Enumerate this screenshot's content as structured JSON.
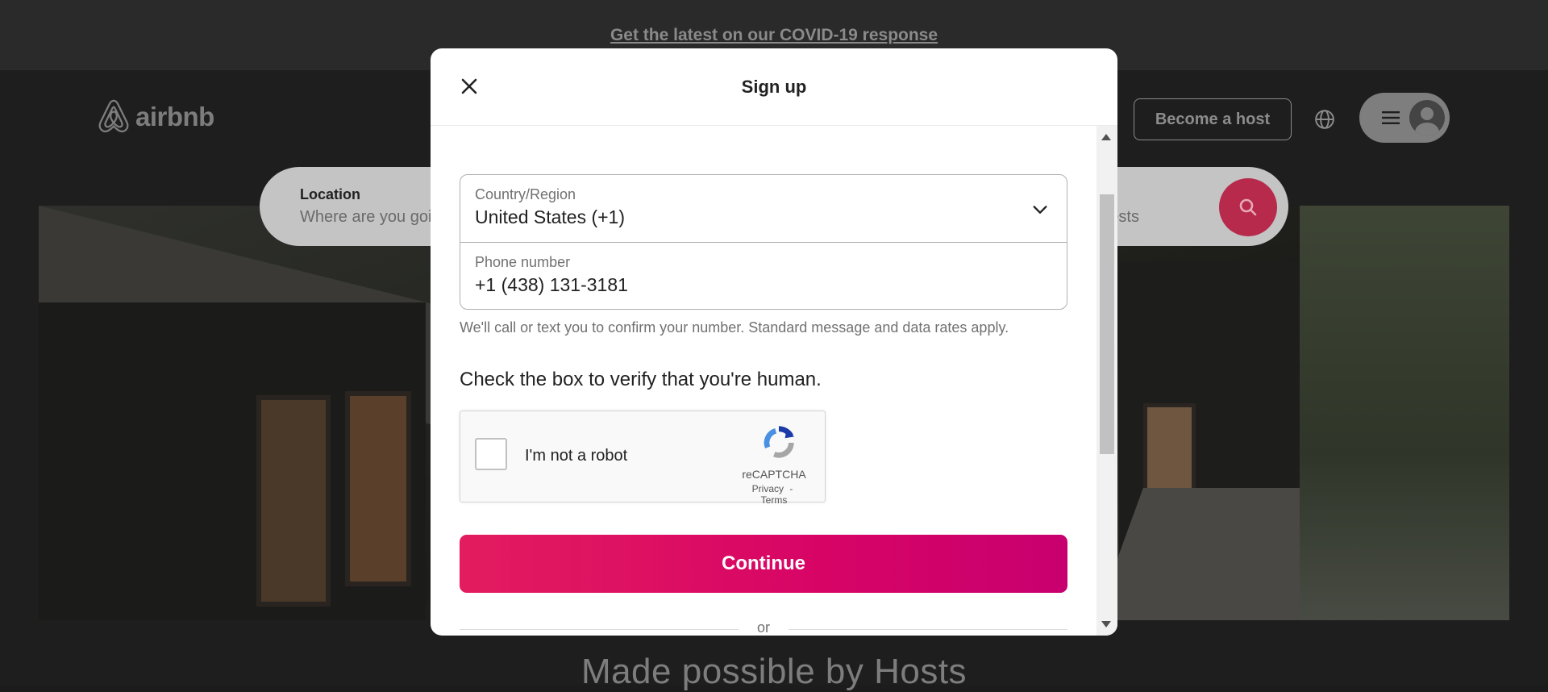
{
  "covid_banner": {
    "link_text": "Get the latest on our COVID-19 response"
  },
  "brand": {
    "logo_text": "airbnb",
    "logo_icon": "airbnb-belo-icon"
  },
  "search": {
    "location_label": "Location",
    "location_placeholder": "Where are you going?",
    "guests_placeholder": "Add guests",
    "search_icon": "search-icon"
  },
  "header": {
    "become_host_label": "Become a host",
    "globe_icon": "globe-icon",
    "menu_icon": "hamburger-menu-icon",
    "avatar_icon": "user-avatar-icon"
  },
  "hero_caption": "Made possible by Hosts",
  "modal": {
    "title": "Sign up",
    "close_icon": "close-icon",
    "country": {
      "label": "Country/Region",
      "value": "United States (+1)",
      "icon": "chevron-down-icon"
    },
    "phone": {
      "label": "Phone number",
      "value": "+1 (438) 131-3181"
    },
    "hint": "We'll call or text you to confirm your number. Standard message and data rates apply.",
    "verify_heading": "Check the box to verify that you're human.",
    "recaptcha": {
      "checkbox_label": "I'm not a robot",
      "brand": "reCAPTCHA",
      "privacy": "Privacy",
      "separator": "-",
      "terms": "Terms",
      "icon": "recaptcha-logo-icon"
    },
    "continue_label": "Continue",
    "divider_text": "or"
  },
  "colors": {
    "brand_gradient_start": "#e31c5f",
    "brand_gradient_end": "#c8006f",
    "overlay_dark": "#1c1c1c"
  }
}
